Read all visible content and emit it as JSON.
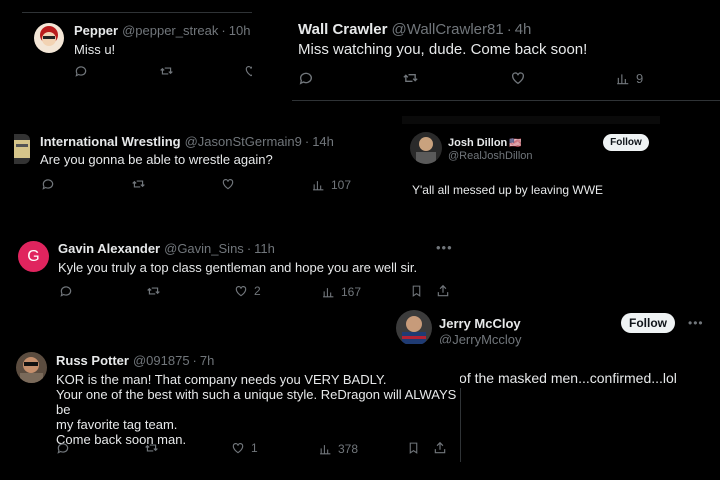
{
  "pepper": {
    "name": "Pepper",
    "handle": "@pepper_streak",
    "time": "10h",
    "text": "Miss u!"
  },
  "wall": {
    "name": "Wall Crawler",
    "handle": "@WallCrawler81",
    "time": "4h",
    "text": "Miss watching you, dude. Come back soon!",
    "views": "9"
  },
  "intl": {
    "name": "International Wrestling",
    "handle": "@JasonStGermain9",
    "time": "14h",
    "text": "Are you gonna be able to wrestle again?",
    "views": "107"
  },
  "josh": {
    "name": "Josh Dillon",
    "flag": "🇺🇸",
    "handle": "@RealJoshDillon",
    "follow": "Follow",
    "text": "Y'all all messed up by leaving WWE"
  },
  "gavin": {
    "initial": "G",
    "name": "Gavin Alexander",
    "handle": "@Gavin_Sins",
    "time": "11h",
    "text": "Kyle you truly a top class gentleman and hope you are well sir.",
    "likes": "2",
    "views": "167",
    "avatar_color": "#e0245e"
  },
  "jerry": {
    "name": "Jerry McCloy",
    "handle": "@JerryMccloy",
    "follow": "Follow",
    "text": "He is one of the masked men...confirmed...lol"
  },
  "russ": {
    "name": "Russ Potter",
    "handle": "@091875",
    "time": "7h",
    "lines": [
      "KOR is the man! That company needs you VERY BADLY.",
      "Your one of the best with such a unique style. ReDragon will ALWAYS be",
      "my favorite tag team.",
      "Come back soon man."
    ],
    "likes": "1",
    "views": "378"
  },
  "sep": "·"
}
